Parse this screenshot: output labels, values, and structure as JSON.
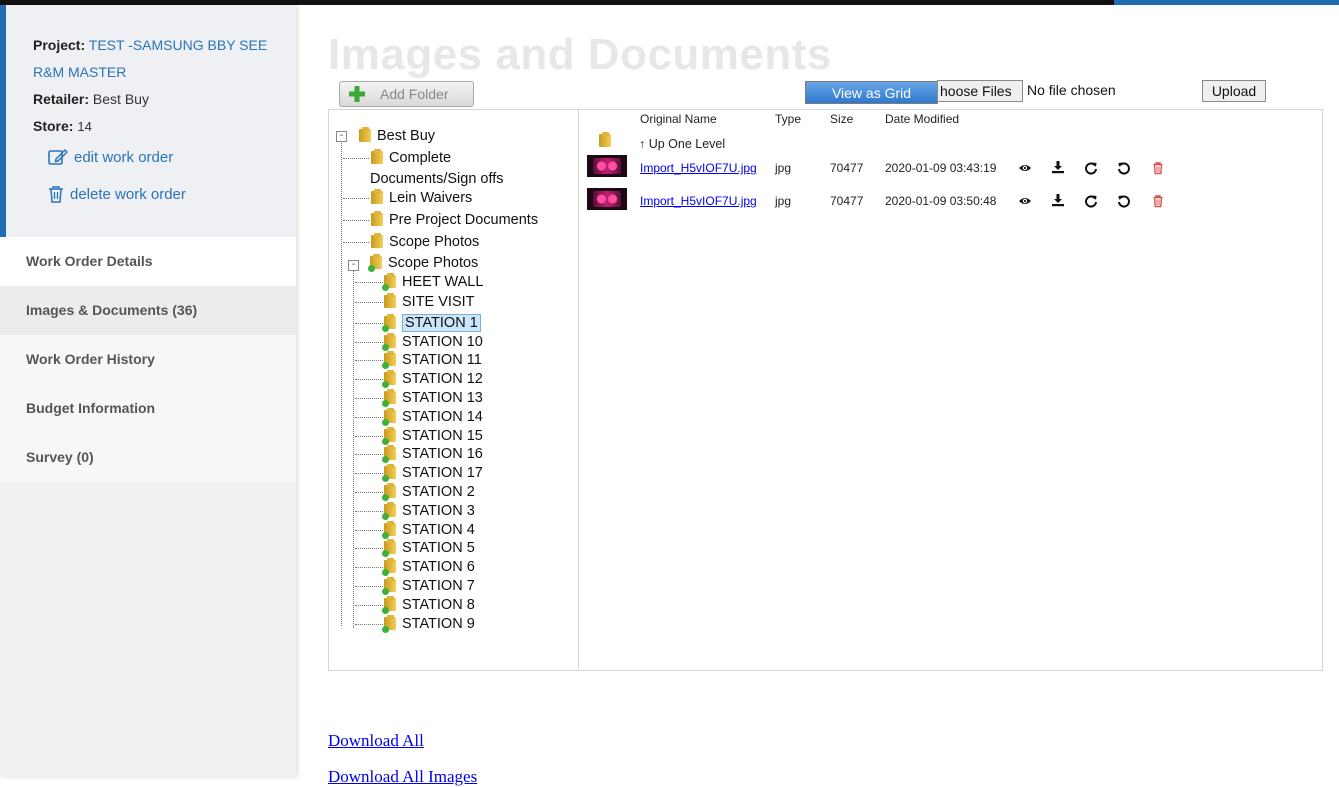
{
  "sidebar": {
    "project_label": "Project:",
    "project_value_line1": "TEST -SAMSUNG BBY SEE",
    "project_value_line2": "R&M MASTER",
    "retailer_label": "Retailer:",
    "retailer_value": "Best Buy",
    "store_label": "Store:",
    "store_value": "14",
    "edit_label": "edit work order",
    "delete_label": "delete work order",
    "nav": [
      {
        "label": "Work Order Details"
      },
      {
        "label": "Images & Documents (36)"
      },
      {
        "label": "Work Order History"
      },
      {
        "label": "Budget Information"
      },
      {
        "label": "Survey (0)"
      }
    ]
  },
  "main": {
    "title": "Images and Documents",
    "add_folder": "Add Folder",
    "view_as_grid": "View as Grid",
    "choose_files": "hoose Files",
    "no_file": "No file chosen",
    "upload": "Upload"
  },
  "tree": {
    "root": "Best Buy",
    "children": [
      {
        "label_line1": "Complete",
        "label_line2": "Documents/Sign offs"
      },
      {
        "label": "Lein Waivers"
      },
      {
        "label": "Pre Project Documents"
      },
      {
        "label": "Scope Photos"
      },
      {
        "label": "Scope Photos"
      }
    ],
    "scope_children": [
      "HEET WALL",
      "SITE VISIT",
      "STATION 1",
      "STATION 10",
      "STATION 11",
      "STATION 12",
      "STATION 13",
      "STATION 14",
      "STATION 15",
      "STATION 16",
      "STATION 17",
      "STATION 2",
      "STATION 3",
      "STATION 4",
      "STATION 5",
      "STATION 6",
      "STATION 7",
      "STATION 8",
      "STATION 9"
    ],
    "selected": "STATION 1"
  },
  "file_list": {
    "headers": {
      "name": "Original Name",
      "type": "Type",
      "size": "Size",
      "modified": "Date Modified"
    },
    "up_level": "↑ Up One Level",
    "rows": [
      {
        "name": "Import_H5vIOF7U.jpg",
        "type": "jpg",
        "size": "70477",
        "modified": "2020-01-09 03:43:19"
      },
      {
        "name": "Import_H5vIOF7U.jpg",
        "type": "jpg",
        "size": "70477",
        "modified": "2020-01-09 03:50:48"
      }
    ]
  },
  "links": {
    "download_all": "Download All",
    "download_all_images": "Download All Images"
  },
  "colors": {
    "accent": "#1f6db3",
    "link": "#0000ee",
    "delete_icon": "#d9534f"
  }
}
